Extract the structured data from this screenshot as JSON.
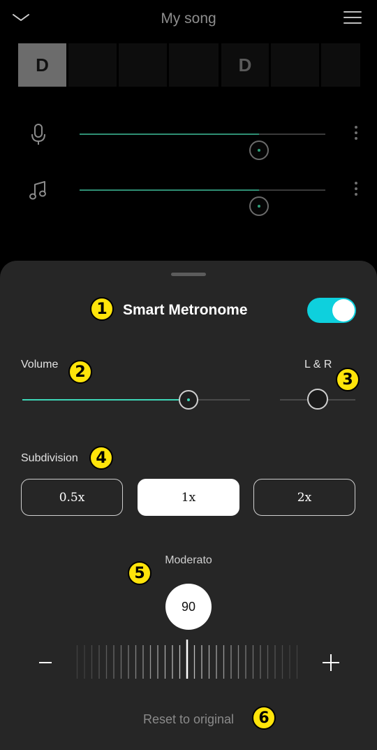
{
  "header": {
    "title": "My song"
  },
  "chords": [
    {
      "label": "D",
      "active": true
    },
    {
      "label": "",
      "active": false
    },
    {
      "label": "",
      "active": false
    },
    {
      "label": "",
      "active": false
    },
    {
      "label": "D",
      "active": false
    },
    {
      "label": "",
      "active": false
    },
    {
      "label": "",
      "active": false
    }
  ],
  "tracks": [
    {
      "icon": "microphone-icon",
      "level": 0.73
    },
    {
      "icon": "music-note-icon",
      "level": 0.73
    }
  ],
  "metronome": {
    "title": "Smart Metronome",
    "enabled": true,
    "volume_label": "Volume",
    "volume_level": 0.73,
    "pan_label": "L & R",
    "pan_level": 0.5,
    "subdivision_label": "Subdivision",
    "subdivision_options": [
      "0.5x",
      "1x",
      "2x"
    ],
    "subdivision_selected": "1x",
    "tempo_name": "Moderato",
    "bpm": "90",
    "reset_label": "Reset to original"
  },
  "annotations": [
    "1",
    "2",
    "3",
    "4",
    "5",
    "6"
  ],
  "colors": {
    "accent": "#0ed0dd",
    "slider": "#3ed7b7",
    "badge": "#ffe40a",
    "sheet": "#262626"
  }
}
